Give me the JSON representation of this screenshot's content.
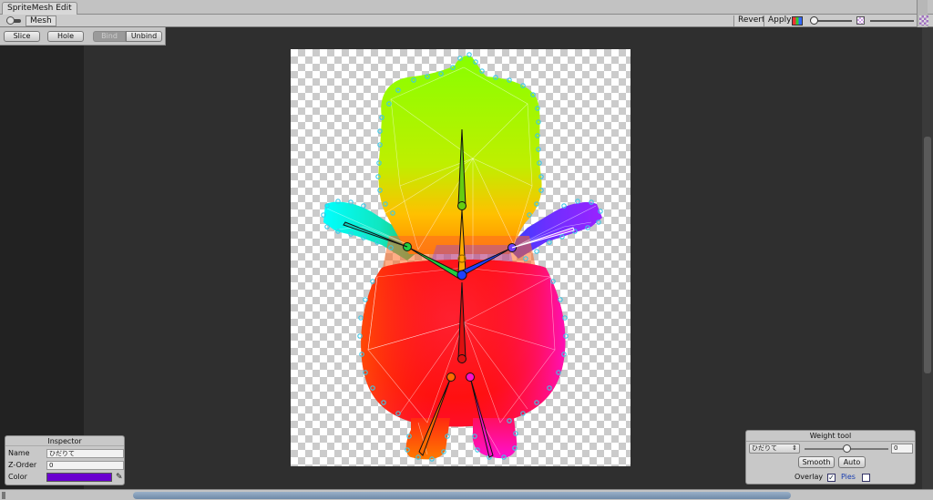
{
  "window": {
    "tab_title": "SpriteMesh Edit"
  },
  "toolbar": {
    "mode_label": "Mesh",
    "revert_label": "Revert",
    "apply_label": "Apply",
    "color_icon": "color-channels-icon",
    "checker_icon": "alpha-checker-icon",
    "zoom_slider": {
      "level": 0.0
    },
    "alpha_slider": {
      "level": 1.0
    }
  },
  "edit_panel": {
    "slice_label": "Slice",
    "hole_label": "Hole",
    "bind_label": "Bind",
    "unbind_label": "Unbind"
  },
  "inspector": {
    "title": "Inspector",
    "name_label": "Name",
    "name_value": "ひだりて",
    "zorder_label": "Z-Order",
    "zorder_value": "0",
    "color_label": "Color",
    "color_value": "#6a00d0",
    "picker_icon": "eyedropper-icon"
  },
  "weight_tool": {
    "title": "Weight tool",
    "bone_selected": "ひだりて",
    "weight_level": 0.5,
    "weight_value": "0",
    "smooth_label": "Smooth",
    "auto_label": "Auto",
    "overlay_label": "Overlay",
    "overlay_checked": true,
    "pies_label": "Pies",
    "pies_checked": false
  },
  "colors": {
    "head": "#88ff00",
    "body": "#ff1010",
    "arm_right_cyan": "#00ffff",
    "arm_left_violet": "#9a22ff",
    "leg_orange": "#ff6a00",
    "leg_magenta": "#ff10c8",
    "vertex": "#3cc8e8"
  }
}
